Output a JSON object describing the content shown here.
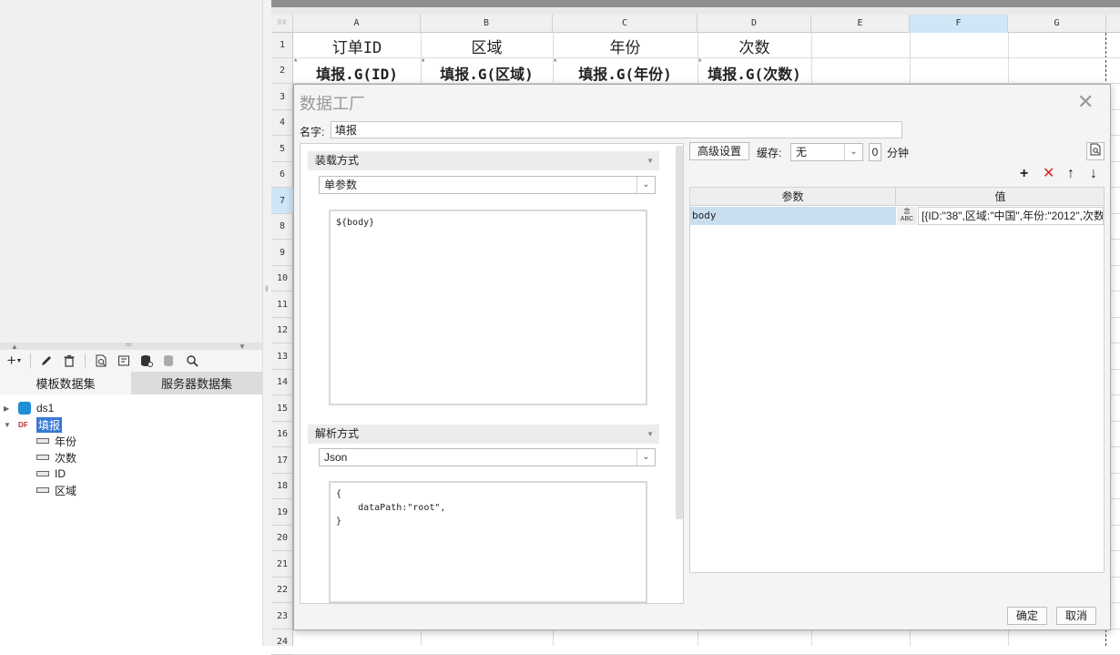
{
  "left_panel": {
    "toolbar_icons": [
      "add-icon",
      "edit-icon",
      "delete-icon",
      "preview-icon",
      "server-dataset-icon",
      "database-icon",
      "database-gray-icon",
      "search-icon"
    ],
    "tabs": [
      {
        "label": "模板数据集",
        "active": true
      },
      {
        "label": "服务器数据集",
        "active": false
      }
    ],
    "tree": {
      "ds1": "ds1",
      "selected_node": "填报",
      "selected_prefix": "DF",
      "fields": [
        "年份",
        "次数",
        "ID",
        "区域"
      ]
    }
  },
  "sheet": {
    "columns": [
      "A",
      "B",
      "C",
      "D",
      "E",
      "F",
      "G"
    ],
    "selected_column": "F",
    "rows": [
      "1",
      "2",
      "3",
      "4",
      "5",
      "6",
      "7",
      "8",
      "9",
      "10",
      "11",
      "12",
      "13",
      "14",
      "15",
      "16",
      "17",
      "18",
      "19",
      "20",
      "21",
      "22",
      "23",
      "24"
    ],
    "selected_row": "7",
    "row1": [
      "订单ID",
      "区域",
      "年份",
      "次数"
    ],
    "row2": [
      "填报.G(ID)",
      "填报.G(区域)",
      "填报.G(年份)",
      "填报.G(次数)"
    ]
  },
  "dialog": {
    "title": "数据工厂",
    "name_label": "名字:",
    "name_value": "填报",
    "load": {
      "header": "装载方式",
      "mode": "单参数",
      "body": "${body}"
    },
    "parse": {
      "header": "解析方式",
      "mode": "Json",
      "body": "{\n    dataPath:\"root\",\n}"
    },
    "advanced_button": "高级设置",
    "cache_label": "缓存:",
    "cache_value": "无",
    "cache_minutes": "0",
    "minutes_label": "分钟",
    "param_table": {
      "headers": [
        "参数",
        "值"
      ],
      "rows": [
        {
          "name": "body",
          "type_label": "念\nABC",
          "value": "[{ID:\"38\",区域:\"中国\",年份:\"2012\",次数"
        }
      ]
    },
    "colors": {
      "add": "#222222",
      "delete": "#e02020",
      "move": "#222222"
    },
    "ok_button": "确定",
    "cancel_button": "取消"
  }
}
